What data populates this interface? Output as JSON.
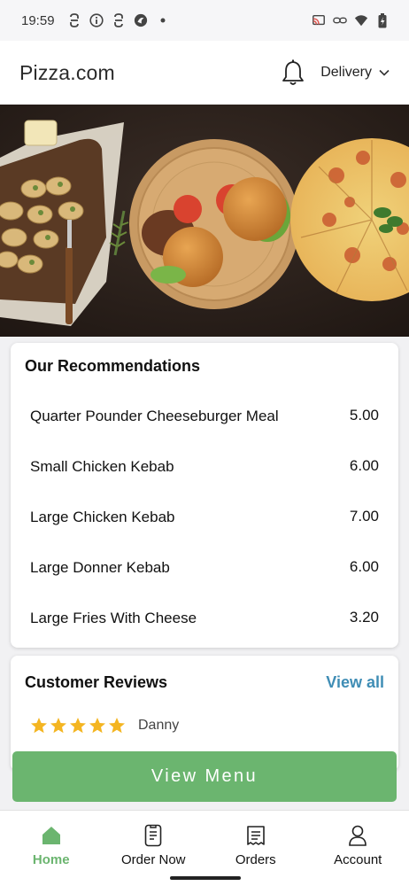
{
  "status_bar": {
    "time": "19:59",
    "left_icons": [
      "sync-icon",
      "info-icon",
      "sync-icon",
      "browser-icon",
      "dot-icon"
    ],
    "right_icons": [
      "cast-icon",
      "link-icon",
      "wifi-icon",
      "battery-icon"
    ]
  },
  "header": {
    "title": "Pizza.com",
    "bell_icon": "bell-icon",
    "mode_label": "Delivery"
  },
  "recommendations": {
    "title": "Our Recommendations",
    "items": [
      {
        "name": "Quarter Pounder Cheeseburger Meal",
        "price": "5.00"
      },
      {
        "name": "Small Chicken Kebab",
        "price": "6.00"
      },
      {
        "name": "Large Chicken Kebab",
        "price": "7.00"
      },
      {
        "name": "Large Donner Kebab",
        "price": "6.00"
      },
      {
        "name": "Large Fries With Cheese",
        "price": "3.20"
      }
    ]
  },
  "reviews": {
    "title": "Customer Reviews",
    "view_all_label": "View all",
    "first_review": {
      "reviewer": "Danny",
      "rating": 5
    }
  },
  "view_menu_label": "View Menu",
  "bottom_nav": {
    "items": [
      {
        "label": "Home",
        "icon": "home-icon",
        "active": true
      },
      {
        "label": "Order Now",
        "icon": "phone-order-icon",
        "active": false
      },
      {
        "label": "Orders",
        "icon": "receipt-icon",
        "active": false
      },
      {
        "label": "Account",
        "icon": "person-icon",
        "active": false
      }
    ]
  },
  "colors": {
    "accent_green": "#6bb56f",
    "link_blue": "#3f8db5",
    "star_gold": "#f4b521"
  }
}
